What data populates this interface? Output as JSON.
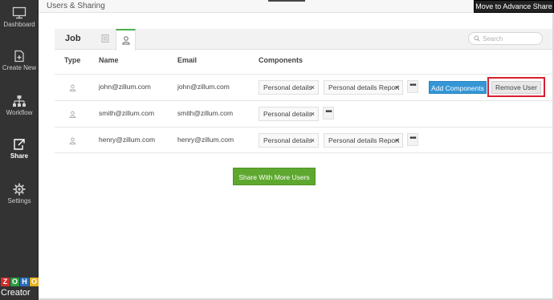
{
  "sidebar": {
    "items": [
      {
        "label": "Dashboard",
        "icon": "monitor-icon"
      },
      {
        "label": "Create New",
        "icon": "new-file-icon"
      },
      {
        "label": "Workflow",
        "icon": "workflow-icon"
      },
      {
        "label": "Share",
        "icon": "share-icon",
        "active": true
      },
      {
        "label": "Settings",
        "icon": "gear-icon"
      }
    ],
    "logo": {
      "letters": [
        "Z",
        "O",
        "H",
        "O"
      ],
      "product": "Creator"
    }
  },
  "header": {
    "breadcrumb": "Users & Sharing",
    "advance_button": "Move to Advance Share"
  },
  "panel": {
    "title": "Job",
    "search_placeholder": "Search",
    "columns": [
      "Type",
      "Name",
      "Email",
      "Components"
    ],
    "rows": [
      {
        "name": "john@zillum.com",
        "email": "john@zillum.com",
        "components": [
          "Personal details",
          "Personal details Report"
        ],
        "actions": {
          "add": "Add Components",
          "remove": "Remove User"
        }
      },
      {
        "name": "smith@zillum.com",
        "email": "smith@zillum.com",
        "components": [
          "Personal details"
        ]
      },
      {
        "name": "henry@zillum.com",
        "email": "henry@zillum.com",
        "components": [
          "Personal details",
          "Personal details Report"
        ]
      }
    ],
    "chip_close": "×",
    "more": "•••"
  },
  "share_more_button": "Share With More Users",
  "colors": {
    "sidebar": "#333333",
    "accent_green": "#5ea830",
    "accent_blue": "#3596d6",
    "highlight_red": "#d9202f"
  }
}
